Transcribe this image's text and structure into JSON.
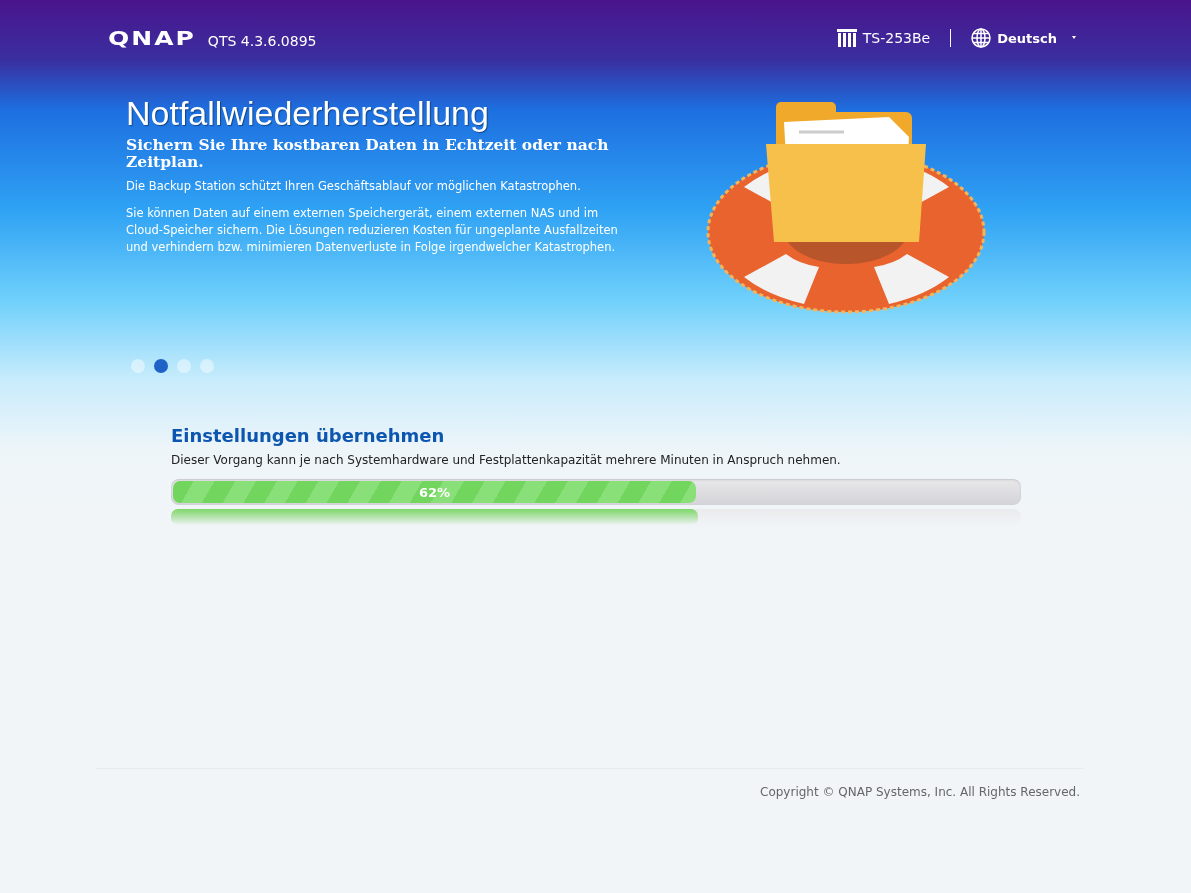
{
  "header": {
    "logo": "QNAP",
    "version": "QTS 4.3.6.0895",
    "device": "TS-253Be",
    "language": "Deutsch"
  },
  "hero": {
    "title": "Notfallwiederherstellung",
    "subtitle": "Sichern Sie Ihre kostbaren Daten in Echtzeit oder nach Zeitplan.",
    "paragraphs": [
      "Die Backup Station schützt Ihren Geschäftsablauf vor möglichen Katastrophen.",
      "Sie können Daten auf einem externen Speichergerät, einem externen NAS und im Cloud-Speicher sichern. Die Lösungen reduzieren Kosten für ungeplante Ausfallzeiten und verhindern bzw. minimieren Datenverluste in Folge irgendwelcher Katastrophen."
    ]
  },
  "slides": [
    {
      "selected": false
    },
    {
      "selected": true
    },
    {
      "selected": false
    },
    {
      "selected": false
    }
  ],
  "progress": {
    "title": "Einstellungen übernehmen",
    "description": "Dieser Vorgang kann je nach Systemhardware und Festplattenkapazität mehrere Minuten in Anspruch nehmen.",
    "level": 0.62,
    "reading": "62%"
  },
  "footer": {
    "copyright": "Copyright © QNAP Systems, Inc. All Rights Reserved."
  }
}
